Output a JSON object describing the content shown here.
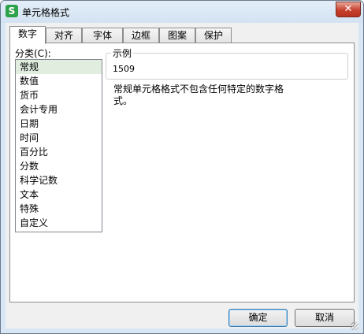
{
  "window": {
    "title": "单元格格式",
    "icon_glyph": "S",
    "icon_name": "wps-spreadsheet-icon",
    "close_glyph": "✕"
  },
  "tabs": [
    {
      "label": "数字",
      "active": true
    },
    {
      "label": "对齐",
      "active": false
    },
    {
      "label": "字体",
      "active": false
    },
    {
      "label": "边框",
      "active": false
    },
    {
      "label": "图案",
      "active": false
    },
    {
      "label": "保护",
      "active": false
    }
  ],
  "category": {
    "label": "分类(C):",
    "items": [
      "常规",
      "数值",
      "货币",
      "会计专用",
      "日期",
      "时间",
      "百分比",
      "分数",
      "科学记数",
      "文本",
      "特殊",
      "自定义"
    ],
    "selected": "常规"
  },
  "sample": {
    "title": "示例",
    "value": "1509"
  },
  "description": "常规单元格格式不包含任何特定的数字格式。",
  "buttons": {
    "ok": "确定",
    "cancel": "取消"
  },
  "colors": {
    "app_icon": "#2ea24a",
    "close_button": "#c7402d",
    "selection": "#e1eedf"
  }
}
